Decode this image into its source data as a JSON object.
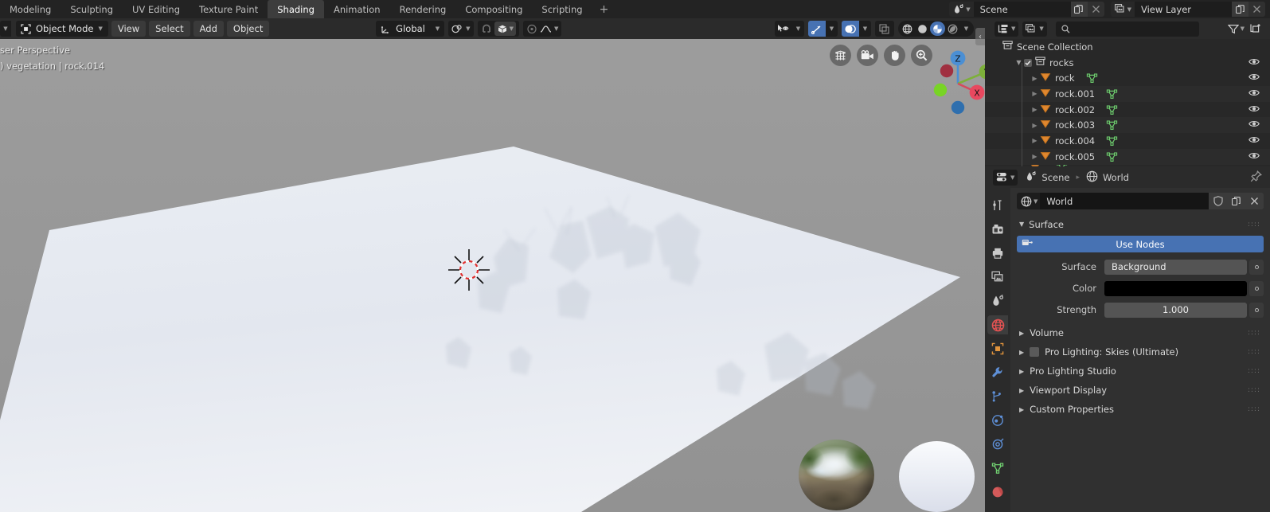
{
  "topbar": {
    "workspace_tabs": [
      {
        "label": "Modeling",
        "active": false
      },
      {
        "label": "Sculpting",
        "active": false
      },
      {
        "label": "UV Editing",
        "active": false
      },
      {
        "label": "Texture Paint",
        "active": false
      },
      {
        "label": "Shading",
        "active": true
      },
      {
        "label": "Animation",
        "active": false
      },
      {
        "label": "Rendering",
        "active": false
      },
      {
        "label": "Compositing",
        "active": false
      },
      {
        "label": "Scripting",
        "active": false
      }
    ],
    "add_workspace_label": "+",
    "scene_name": "Scene",
    "view_layer_name": "View Layer"
  },
  "viewport": {
    "mode": "Object Mode",
    "menus": [
      "View",
      "Select",
      "Add",
      "Object"
    ],
    "transform_orientation": "Global",
    "overlay_line1": "ser Perspective",
    "overlay_line2": ") vegetation | rock.014",
    "nav_buttons": [
      "grid-icon",
      "camera-icon",
      "hand-icon",
      "zoom-icon"
    ],
    "gizmo_axes": [
      "Z",
      "Y",
      "X"
    ],
    "background_color": "#9a9a9a",
    "plane_color": "#e2e6ed",
    "collapse_label": "‹"
  },
  "outliner": {
    "search_placeholder": "",
    "root": "Scene Collection",
    "collection": {
      "name": "rocks",
      "checked": true,
      "expanded": true
    },
    "items": [
      {
        "name": "rock"
      },
      {
        "name": "rock.001"
      },
      {
        "name": "rock.002"
      },
      {
        "name": "rock.003"
      },
      {
        "name": "rock.004"
      },
      {
        "name": "rock.005"
      }
    ]
  },
  "properties": {
    "breadcrumb": [
      {
        "label": "Scene",
        "icon": "scene-icon"
      },
      {
        "label": "World",
        "icon": "world-icon"
      }
    ],
    "id_name": "World",
    "tabs": [
      {
        "name": "tool",
        "active": false
      },
      {
        "name": "render",
        "active": false
      },
      {
        "name": "output",
        "active": false
      },
      {
        "name": "view-layer",
        "active": false
      },
      {
        "name": "scene",
        "active": false
      },
      {
        "name": "world",
        "active": true
      },
      {
        "name": "object",
        "active": false
      },
      {
        "name": "modifiers",
        "active": false
      },
      {
        "name": "particles",
        "active": false
      },
      {
        "name": "physics",
        "active": false
      },
      {
        "name": "constraints",
        "active": false
      },
      {
        "name": "data",
        "active": false
      },
      {
        "name": "material",
        "active": false
      }
    ],
    "surface_panel": {
      "title": "Surface",
      "use_nodes_label": "Use Nodes",
      "fields": [
        {
          "label": "Surface",
          "value": "Background",
          "kind": "enum"
        },
        {
          "label": "Color",
          "value": "",
          "kind": "color",
          "color": "#000000"
        },
        {
          "label": "Strength",
          "value": "1.000",
          "kind": "number"
        }
      ]
    },
    "panels": [
      {
        "label": "Volume",
        "checkbox": false
      },
      {
        "label": "Pro Lighting: Skies (Ultimate)",
        "checkbox": true
      },
      {
        "label": "Pro Lighting Studio",
        "checkbox": false
      },
      {
        "label": "Viewport Display",
        "checkbox": false
      },
      {
        "label": "Custom Properties",
        "checkbox": false
      }
    ]
  },
  "colors": {
    "accent_blue": "#4772b3",
    "header_dark": "#2b2b2b",
    "panel_bg": "#303030",
    "outliner_bg": "#282828",
    "mesh_orange": "#e08c3c",
    "mesh_green": "#5ec25e"
  }
}
